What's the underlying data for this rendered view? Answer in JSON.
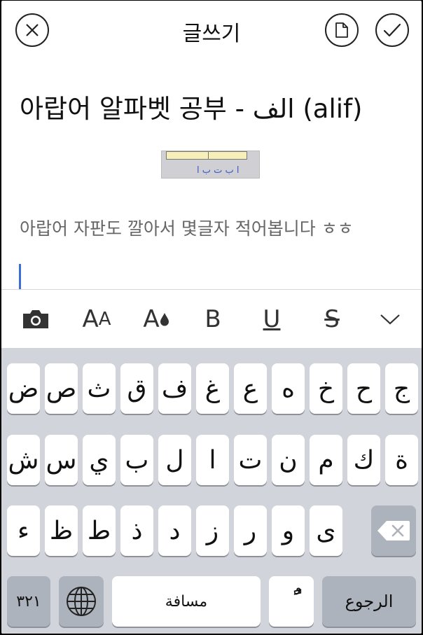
{
  "header": {
    "title": "글쓰기"
  },
  "editor": {
    "post_title": "아랍어 알파벳 공부 - الف (alif)",
    "image_caption": "ا ب ت ب ا",
    "body_text": "아랍어 자판도 깔아서 몇글자 적어봅니다 ㅎㅎ"
  },
  "toolbar": {
    "font_size_large": "A",
    "font_size_small": "A",
    "font_color": "A",
    "bold": "B",
    "underline": "U",
    "strike": "S"
  },
  "keyboard": {
    "row1": [
      "ض",
      "ص",
      "ث",
      "ق",
      "ف",
      "غ",
      "ع",
      "ه",
      "خ",
      "ح",
      "ج"
    ],
    "row2": [
      "ش",
      "س",
      "ي",
      "ب",
      "ل",
      "ا",
      "ت",
      "ن",
      "م",
      "ك",
      "ة"
    ],
    "row3": [
      "ء",
      "ظ",
      "ط",
      "ذ",
      "د",
      "ز",
      "ر",
      "و",
      "ى"
    ],
    "numbers_key": "٣٢١",
    "space_key": "مسافة",
    "diacritic_key": "ًٌ",
    "return_key": "الرجوع"
  },
  "colors": {
    "keyboard_bg": "#d1d5db",
    "cursor": "#3b6fd6",
    "text": "#111111",
    "muted_text": "#666666"
  }
}
